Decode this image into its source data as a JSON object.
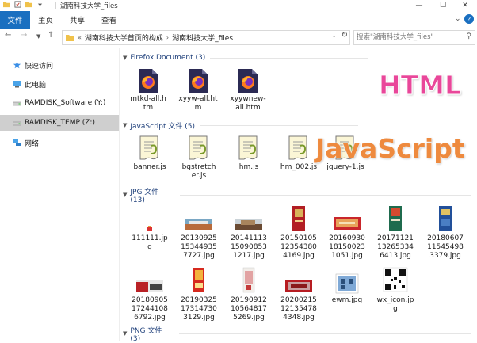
{
  "window": {
    "title": "湖南科技大学_files",
    "buttons": {
      "minimize": "—",
      "maximize": "☐",
      "close": "✕"
    }
  },
  "ribbon": {
    "tabs": [
      "文件",
      "主页",
      "共享",
      "查看"
    ],
    "accent": "#1a6fc0"
  },
  "address": {
    "crumbs": [
      "«",
      "湖南科技大学首页的构成",
      "湖南科技大学_files"
    ],
    "search_placeholder": "搜索\"湖南科技大学_files\""
  },
  "sidebar": {
    "items": [
      {
        "label": "快速访问",
        "icon": "star-icon"
      },
      {
        "label": "此电脑",
        "icon": "computer-icon"
      },
      {
        "label": "RAMDISK_Software (Y:)",
        "icon": "drive-icon"
      },
      {
        "label": "RAMDISK_TEMP (Z:)",
        "icon": "drive-icon",
        "selected": true
      },
      {
        "label": "网络",
        "icon": "network-icon"
      }
    ]
  },
  "groups": [
    {
      "label": "Firefox Document (3)"
    },
    {
      "label": "JavaScript 文件 (5)"
    },
    {
      "label": "JPG 文件 (13)"
    },
    {
      "label": "PNG 文件 (3)"
    }
  ],
  "files": {
    "firefox": [
      "mtkd-all.htm",
      "xyyw-all.htm",
      "xyywnew-all.htm"
    ],
    "javascript": [
      "banner.js",
      "bgstretcher.js",
      "hm.js",
      "hm_002.js",
      "jquery-1.js"
    ],
    "jpg": [
      "111111.jpg",
      "201309251534493577 27.jpg",
      "201411131509085312 17.jpg",
      "201501051235438041 69.jpg",
      "201609301815002310 51.jpg",
      "201711211326533464 13.jpg",
      "201806071154549833 79.jpg",
      "201809051724410867 92.jpg",
      "201903251731473031 29.jpg",
      "201909121056481752 69.jpg",
      "202002151213547843 48.jpg",
      "ewm.jpg",
      "wx_icon.jpg"
    ]
  },
  "file_labels": {
    "firefox": [
      "mtkd-all.h\ntm",
      "xyyw-all.ht\nm",
      "xyywnew-\nall.htm"
    ],
    "javascript": [
      "banner.js",
      "bgstretch\ner.js",
      "hm.js",
      "hm_002.js",
      "jquery-1.js"
    ],
    "jpg": [
      "111111.jp\ng",
      "20130925\n15344935\n7727.jpg",
      "20141113\n15090853\n1217.jpg",
      "20150105\n12354380\n4169.jpg",
      "20160930\n18150023\n1051.jpg",
      "20171121\n13265334\n6413.jpg",
      "20180607\n11545498\n3379.jpg",
      "20180905\n17244108\n6792.jpg",
      "20190325\n17314730\n3129.jpg",
      "20190912\n10564817\n5269.jpg",
      "20200215\n12135478\n4348.jpg",
      "ewm.jpg",
      "wx_icon.jp\ng"
    ]
  },
  "overlays": {
    "html": "HTML",
    "javascript": "JavaScript"
  }
}
